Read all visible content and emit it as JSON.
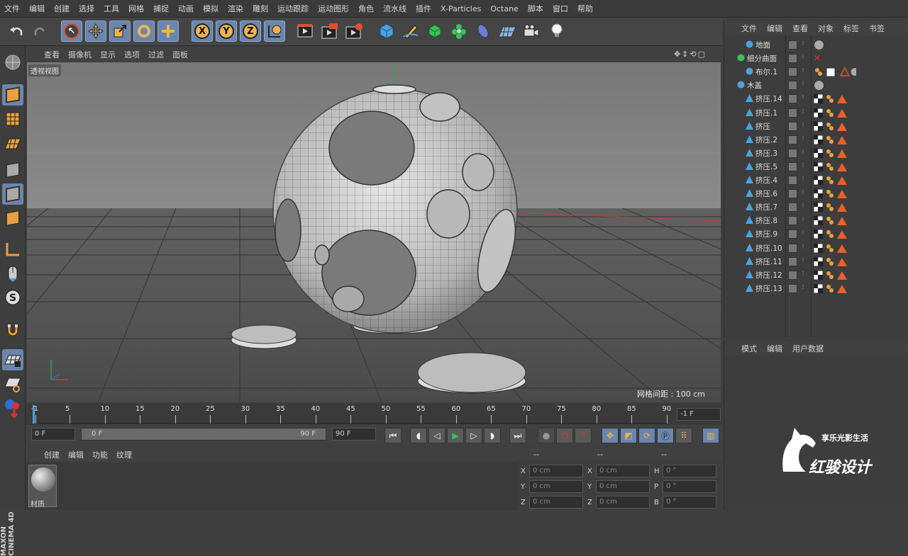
{
  "menubar": [
    "文件",
    "编辑",
    "创建",
    "选择",
    "工具",
    "网格",
    "捕捉",
    "动画",
    "模拟",
    "渲染",
    "雕刻",
    "运动跟踪",
    "运动图形",
    "角色",
    "流水线",
    "插件",
    "X-Particles",
    "Octane",
    "脚本",
    "窗口",
    "帮助"
  ],
  "viewport": {
    "menu": [
      "查看",
      "摄像机",
      "显示",
      "选项",
      "过滤",
      "面板"
    ],
    "label": "透视视图",
    "grid_info": "网格间距 : 100 cm"
  },
  "toolbar": {
    "axis_x": "X",
    "axis_y": "Y",
    "axis_z": "Z"
  },
  "timeline": {
    "ticks": [
      "-1",
      "5",
      "10",
      "15",
      "20",
      "25",
      "30",
      "35",
      "40",
      "45",
      "50",
      "55",
      "60",
      "65",
      "70",
      "75",
      "80",
      "85",
      "90"
    ],
    "end_field": "-1 F"
  },
  "transport": {
    "start": "0 F",
    "range_start": "0 F",
    "range_end": "90 F",
    "end": "90 F"
  },
  "material": {
    "menu": [
      "创建",
      "编辑",
      "功能",
      "纹理"
    ],
    "item_label": "材质"
  },
  "coords": {
    "headers": [
      "--",
      "--",
      "--"
    ],
    "rows": [
      {
        "a": "X",
        "av": "0 cm",
        "b": "X",
        "bv": "0 cm",
        "c": "H",
        "cv": "0 °"
      },
      {
        "a": "Y",
        "av": "0 cm",
        "b": "Y",
        "bv": "0 cm",
        "c": "P",
        "cv": "0 °"
      },
      {
        "a": "Z",
        "av": "0 cm",
        "b": "Z",
        "bv": "0 cm",
        "c": "B",
        "cv": "0 °"
      }
    ]
  },
  "objects": {
    "menu": [
      "文件",
      "编辑",
      "查看",
      "对象",
      "标签",
      "书签"
    ],
    "items": [
      {
        "name": "地面",
        "tags": "sphere"
      },
      {
        "name": "细分曲面",
        "tags": "x"
      },
      {
        "name": "布尔.1",
        "tags": "boole"
      },
      {
        "name": "木盖",
        "tags": "sphere"
      },
      {
        "name": "挤压.14",
        "tags": "extrude"
      },
      {
        "name": "挤压.1",
        "tags": "extrude"
      },
      {
        "name": "挤压",
        "tags": "extrude"
      },
      {
        "name": "挤压.2",
        "tags": "extrude"
      },
      {
        "name": "挤压.3",
        "tags": "extrude"
      },
      {
        "name": "挤压.5",
        "tags": "extrude"
      },
      {
        "name": "挤压.4",
        "tags": "extrude"
      },
      {
        "name": "挤压.6",
        "tags": "extrude"
      },
      {
        "name": "挤压.7",
        "tags": "extrude"
      },
      {
        "name": "挤压.8",
        "tags": "extrude"
      },
      {
        "name": "挤压.9",
        "tags": "extrude"
      },
      {
        "name": "挤压.10",
        "tags": "extrude"
      },
      {
        "name": "挤压.11",
        "tags": "extrude"
      },
      {
        "name": "挤压.12",
        "tags": "extrude"
      },
      {
        "name": "挤压.13",
        "tags": "extrude"
      }
    ]
  },
  "attributes": {
    "menu": [
      "模式",
      "编辑",
      "用户数据"
    ]
  },
  "watermark": {
    "line1": "享乐光影生活",
    "line2": "红骏设计"
  },
  "brand_vertical": "MAXON CINEMA 4D",
  "colors": {
    "accent": "#6a86ad",
    "orange": "#e8a040",
    "red": "#e05030"
  }
}
